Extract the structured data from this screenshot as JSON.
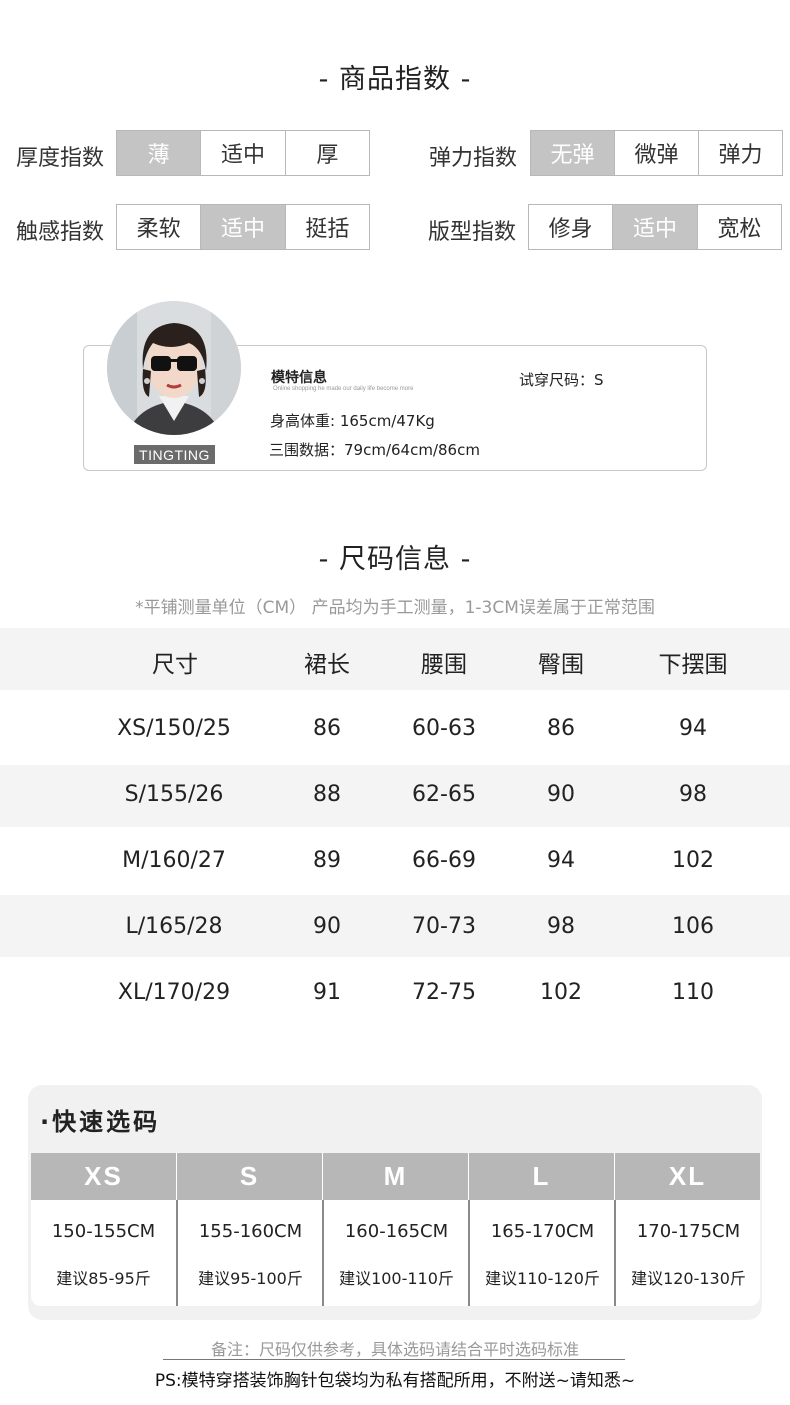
{
  "product_index": {
    "title": "- 商品指数 -",
    "thickness": {
      "label": "厚度指数",
      "options": [
        "薄",
        "适中",
        "厚"
      ],
      "selected": "薄"
    },
    "elasticity": {
      "label": "弹力指数",
      "options": [
        "无弹",
        "微弹",
        "弹力"
      ],
      "selected": "无弹"
    },
    "touch": {
      "label": "触感指数",
      "options": [
        "柔软",
        "适中",
        "挺括"
      ],
      "selected": "适中"
    },
    "fit": {
      "label": "版型指数",
      "options": [
        "修身",
        "适中",
        "宽松"
      ],
      "selected": "适中"
    }
  },
  "model": {
    "name": "TINGTING",
    "heading": "模特信息",
    "tagline": "Online shopping he made our daily life become more",
    "try_size": "试穿尺码：S",
    "height_weight": "身高体重: 165cm/47Kg",
    "measurements": "三围数据：79cm/64cm/86cm"
  },
  "size_info": {
    "title": "- 尺码信息 -",
    "note": "*平铺测量单位（CM） 产品均为手工测量，1-3CM误差属于正常范围",
    "headers": [
      "尺寸",
      "裙长",
      "腰围",
      "臀围",
      "下摆围"
    ],
    "rows": [
      [
        "XS/150/25",
        "86",
        "60-63",
        "86",
        "94"
      ],
      [
        "S/155/26",
        "88",
        "62-65",
        "90",
        "98"
      ],
      [
        "M/160/27",
        "89",
        "66-69",
        "94",
        "102"
      ],
      [
        "L/165/28",
        "90",
        "70-73",
        "98",
        "106"
      ],
      [
        "XL/170/29",
        "91",
        "72-75",
        "102",
        "110"
      ]
    ]
  },
  "quick_select": {
    "title": "·快速选码",
    "sizes": [
      {
        "size": "XS",
        "range": "150-155CM",
        "weight": "建议85-95斤"
      },
      {
        "size": "S",
        "range": "155-160CM",
        "weight": "建议95-100斤"
      },
      {
        "size": "M",
        "range": "160-165CM",
        "weight": "建议100-110斤"
      },
      {
        "size": "L",
        "range": "165-170CM",
        "weight": "建议110-120斤"
      },
      {
        "size": "XL",
        "range": "170-175CM",
        "weight": "建议120-130斤"
      }
    ]
  },
  "footer": {
    "remark": "备注：尺码仅供参考，具体选码请结合平时选码标准",
    "ps": "PS:模特穿搭装饰胸针包袋均为私有搭配所用，不附送~请知悉~"
  }
}
